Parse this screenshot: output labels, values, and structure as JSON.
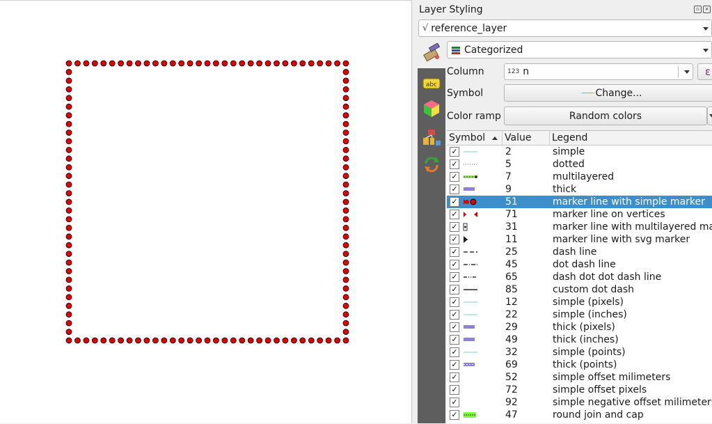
{
  "panel": {
    "title": "Layer Styling"
  },
  "layer_combo": {
    "value": "reference_layer",
    "icon": "line-layer-icon"
  },
  "renderer_combo": {
    "value": "Categorized",
    "icon": "categorized-renderer-icon"
  },
  "column": {
    "label": "Column",
    "type_badge": "123",
    "value": "n",
    "icon": "expression-icon"
  },
  "symbol": {
    "label": "Symbol",
    "button": "Change..."
  },
  "color_ramp": {
    "label": "Color ramp",
    "value": "Random colors"
  },
  "table": {
    "headers": {
      "symbol": "Symbol",
      "value": "Value",
      "legend": "Legend"
    },
    "rows": [
      {
        "value": "2",
        "legend": "simple",
        "sym": "thin-teal",
        "checked": true
      },
      {
        "value": "5",
        "legend": "dotted",
        "sym": "dotted",
        "checked": true
      },
      {
        "value": "7",
        "legend": "multilayered",
        "sym": "multilayered",
        "checked": true
      },
      {
        "value": "9",
        "legend": "thick",
        "sym": "thick-purple",
        "checked": true
      },
      {
        "value": "51",
        "legend": "marker line with simple marker",
        "sym": "marker-red",
        "checked": true,
        "selected": true
      },
      {
        "value": "71",
        "legend": "marker line on vertices",
        "sym": "marker-vertices",
        "checked": true
      },
      {
        "value": "31",
        "legend": "marker line with multilayered mar",
        "sym": "marker-multi",
        "checked": true
      },
      {
        "value": "11",
        "legend": "marker line with svg marker",
        "sym": "marker-svg",
        "checked": true
      },
      {
        "value": "25",
        "legend": "dash line",
        "sym": "dash",
        "checked": true
      },
      {
        "value": "45",
        "legend": "dot dash line",
        "sym": "dot-dash",
        "checked": true
      },
      {
        "value": "65",
        "legend": "dash dot dot dash line",
        "sym": "dash-dot-dot",
        "checked": true
      },
      {
        "value": "85",
        "legend": "custom dot dash",
        "sym": "solid-black",
        "checked": true
      },
      {
        "value": "12",
        "legend": "simple (pixels)",
        "sym": "thin-teal",
        "checked": true
      },
      {
        "value": "22",
        "legend": "simple (inches)",
        "sym": "thin-teal",
        "checked": true
      },
      {
        "value": "29",
        "legend": "thick (pixels)",
        "sym": "thick-purple",
        "checked": true
      },
      {
        "value": "49",
        "legend": "thick (inches)",
        "sym": "thick-purple",
        "checked": true
      },
      {
        "value": "32",
        "legend": "simple (points)",
        "sym": "thin-teal",
        "checked": true
      },
      {
        "value": "69",
        "legend": "thick (points)",
        "sym": "thick-purple-dashed",
        "checked": true
      },
      {
        "value": "52",
        "legend": "simple offset milimeters",
        "sym": "none",
        "checked": true
      },
      {
        "value": "72",
        "legend": "simple  offset pixels",
        "sym": "none",
        "checked": true
      },
      {
        "value": "92",
        "legend": "simple  negative offset milimeters",
        "sym": "none",
        "checked": true
      },
      {
        "value": "47",
        "legend": "round join and cap",
        "sym": "green-thick",
        "checked": true
      }
    ]
  },
  "map": {
    "marker_color": "#e00000",
    "marker_stroke": "#000000",
    "count_per_side": 32
  },
  "colors": {
    "selection": "#3d8ec9",
    "sidebar": "#5e5e5e"
  }
}
